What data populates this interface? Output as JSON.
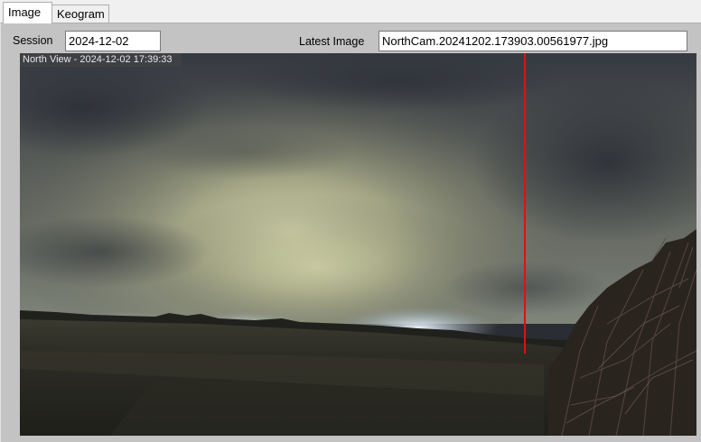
{
  "tabs": [
    {
      "label": "Image",
      "active": true
    },
    {
      "label": "Keogram",
      "active": false
    }
  ],
  "session": {
    "label": "Session",
    "value": "2024-12-02"
  },
  "latest_image": {
    "label": "Latest Image",
    "value": "NorthCam.20241202.173903.00561977.jpg"
  },
  "image_view": {
    "overlay_title": "North View - 2024-12-02 17:39:33",
    "marker_color": "#e01010"
  }
}
